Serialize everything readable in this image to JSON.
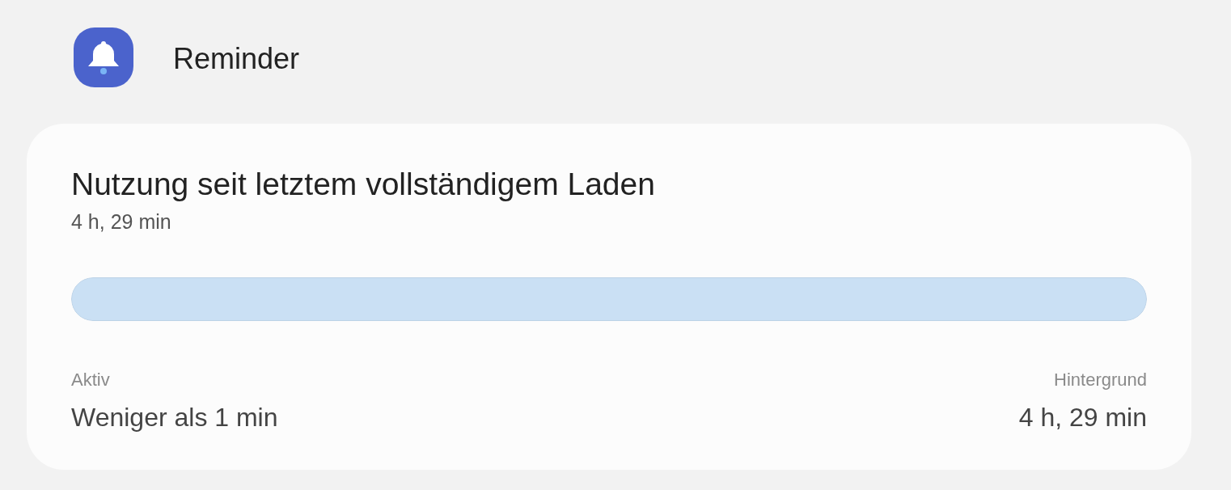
{
  "app": {
    "name": "Reminder"
  },
  "usage": {
    "title": "Nutzung seit letztem vollständigem Laden",
    "total": "4 h, 29 min",
    "bar": {
      "level": 1
    },
    "stats": [
      {
        "label": "Aktiv",
        "value": "Weniger als 1 min"
      },
      {
        "label": "Hintergrund",
        "value": "4 h, 29 min"
      }
    ]
  }
}
